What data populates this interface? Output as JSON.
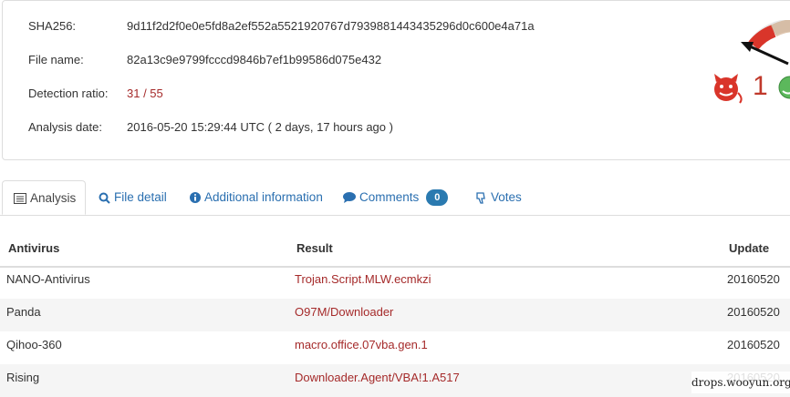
{
  "summary": {
    "sha256_label": "SHA256:",
    "sha256_value": "9d11f2d2f0e0e5fd8a2ef552a5521920767d7939881443435296d0c600e4a71a",
    "filename_label": "File name:",
    "filename_value": "82a13c9e9799fcccd9846b7ef1b99586d075e432",
    "detection_label": "Detection ratio:",
    "detection_value": "31 / 55",
    "date_label": "Analysis date:",
    "date_value": "2016-05-20 15:29:44 UTC ( 2 days, 17 hours ago )"
  },
  "gauge": {
    "evil_icon": "devil-face-icon",
    "good_icon": "smiley-face-icon",
    "evil_count": "1",
    "colors": {
      "red": "#d9352a",
      "green": "#5cb85c",
      "evil": "#c0392b"
    }
  },
  "tabs": {
    "analysis": "Analysis",
    "file_detail": "File detail",
    "additional_info": "Additional information",
    "comments": "Comments",
    "comments_count": "0",
    "votes": "Votes"
  },
  "table": {
    "headers": {
      "antivirus": "Antivirus",
      "result": "Result",
      "update": "Update"
    },
    "rows": [
      {
        "antivirus": "NANO-Antivirus",
        "result": "Trojan.Script.MLW.ecmkzi",
        "update": "20160520"
      },
      {
        "antivirus": "Panda",
        "result": "O97M/Downloader",
        "update": "20160520"
      },
      {
        "antivirus": "Qihoo-360",
        "result": "macro.office.07vba.gen.1",
        "update": "20160520"
      },
      {
        "antivirus": "Rising",
        "result": "Downloader.Agent/VBA!1.A517",
        "update": "20160520"
      }
    ]
  },
  "watermark": "drops.wooyun.org"
}
